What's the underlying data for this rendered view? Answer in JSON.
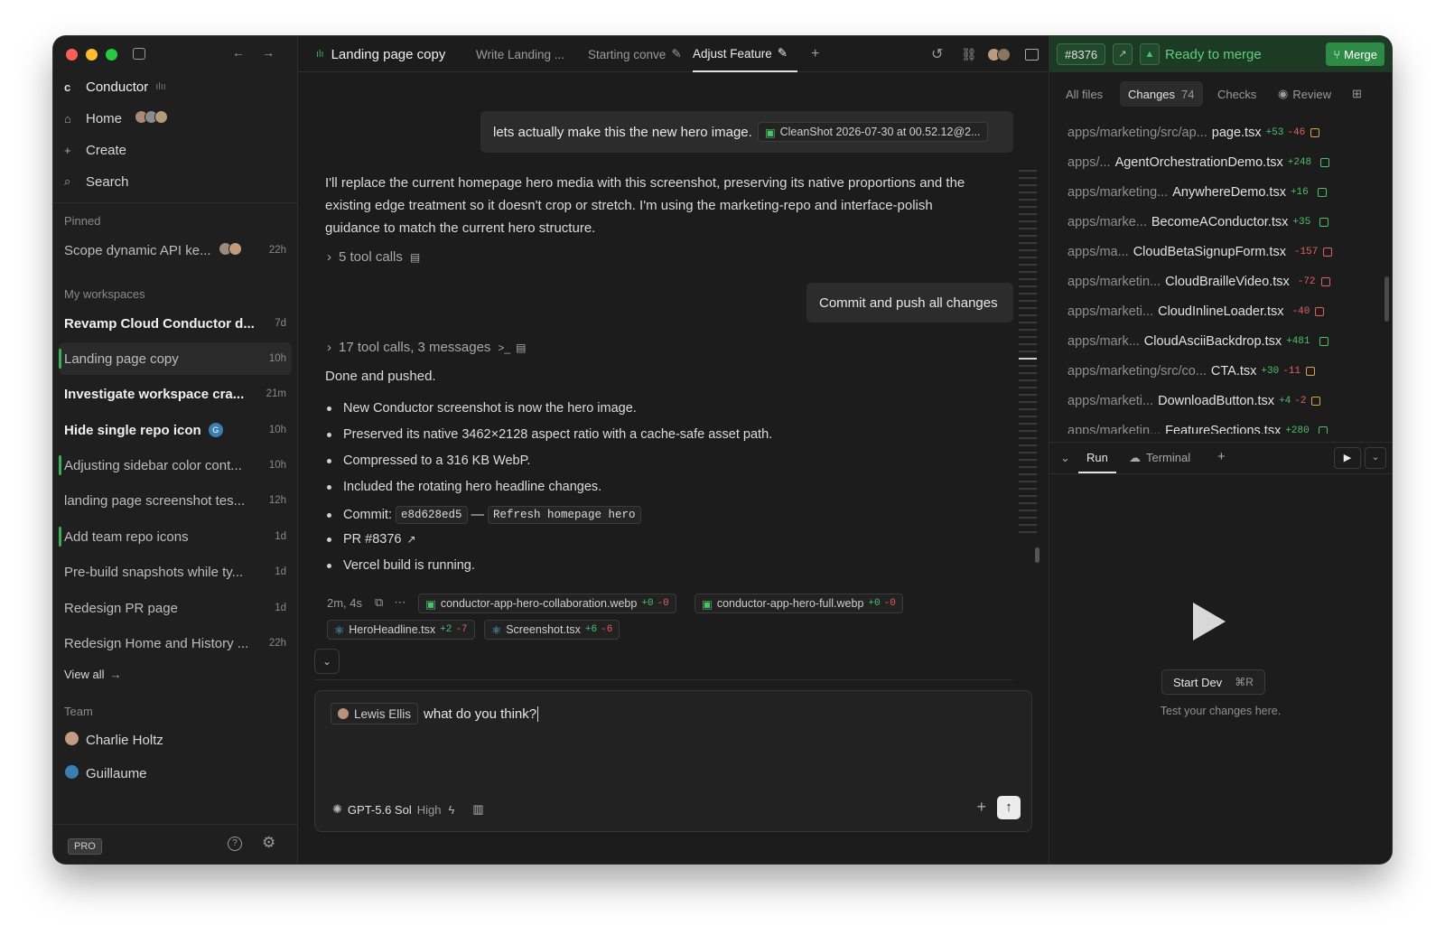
{
  "sidebar": {
    "app_name": "Conductor",
    "nav": [
      {
        "label": "Home",
        "icon": "home-icon"
      },
      {
        "label": "Create",
        "icon": "plus-icon"
      },
      {
        "label": "Search",
        "icon": "search-icon"
      }
    ],
    "pinned_heading": "Pinned",
    "pinned": [
      {
        "title": "Scope dynamic API ke...",
        "time": "22h"
      }
    ],
    "workspaces_heading": "My workspaces",
    "workspaces": [
      {
        "title": "Revamp Cloud Conductor d...",
        "time": "7d"
      },
      {
        "title": "Landing page copy",
        "time": "10h"
      },
      {
        "title": "Investigate workspace cra...",
        "time": "21m"
      },
      {
        "title": "Hide single repo icon",
        "time": "10h"
      },
      {
        "title": "Adjusting sidebar color cont...",
        "time": "10h"
      },
      {
        "title": "landing page screenshot tes...",
        "time": "12h"
      },
      {
        "title": "Add team repo icons",
        "time": "1d"
      },
      {
        "title": "Pre-build snapshots while ty...",
        "time": "1d"
      },
      {
        "title": "Redesign PR page",
        "time": "1d"
      },
      {
        "title": "Redesign Home and History ...",
        "time": "22h"
      }
    ],
    "view_all": "View all",
    "team_heading": "Team",
    "team": [
      "Charlie Holtz",
      "Guillaume"
    ],
    "pro_badge": "PRO",
    "repo_badge": "G"
  },
  "tabs": {
    "first": "Landing page copy",
    "items": [
      "Write Landing ...",
      "Starting conve",
      "Adjust Feature"
    ],
    "add": "+"
  },
  "chat": {
    "user_msg_1": "lets actually make this the new hero image.",
    "attachment": "CleanShot 2026-07-30 at 00.52.12@2...",
    "assistant_para": "I'll replace the current homepage hero media with this screenshot, preserving its native proportions and the existing edge treatment so it doesn't crop or stretch. I'm using the marketing-repo and interface-polish guidance to match the current hero structure.",
    "tool_calls_1": "5 tool calls",
    "user_msg_2": "Commit and push all changes",
    "tool_calls_2": "17 tool calls, 3 messages",
    "done": "Done and pushed.",
    "bullets": [
      "New Conductor screenshot is now the hero image.",
      "Preserved its native 3462×2128 aspect ratio with a cache-safe asset path.",
      "Compressed to a 316 KB WebP.",
      "Included the rotating hero headline changes."
    ],
    "commit_label": "Commit:",
    "commit_hash": "e8d628ed5",
    "commit_dash": "—",
    "commit_msg": "Refresh homepage hero",
    "pr_label": "PR #8376",
    "vercel": "Vercel build is running.",
    "duration": "2m, 4s",
    "file_chips": [
      {
        "name": "conductor-app-hero-collaboration.webp",
        "plus": "+0",
        "minus": "-0"
      },
      {
        "name": "conductor-app-hero-full.webp",
        "plus": "+0",
        "minus": "-0"
      },
      {
        "name": "HeroHeadline.tsx",
        "plus": "+2",
        "minus": "-7"
      },
      {
        "name": "Screenshot.tsx",
        "plus": "+6",
        "minus": "-6"
      }
    ]
  },
  "composer": {
    "mention": "Lewis Ellis",
    "text": "what do you think?",
    "model": "GPT-5.6 Sol",
    "effort": "High"
  },
  "right": {
    "pr_number": "#8376",
    "status": "Ready to merge",
    "merge": "Merge",
    "tabs": [
      "All files",
      "Changes",
      "Checks",
      "Review"
    ],
    "changes_count": "74",
    "files": [
      {
        "path": "apps/marketing/src/ap...",
        "name": "page.tsx",
        "plus": "+53",
        "minus": "-46",
        "kind": "mod"
      },
      {
        "path": "apps/...",
        "name": "AgentOrchestrationDemo.tsx",
        "plus": "+248",
        "minus": "",
        "kind": "add"
      },
      {
        "path": "apps/marketing...",
        "name": "AnywhereDemo.tsx",
        "plus": "+16",
        "minus": "",
        "kind": "add"
      },
      {
        "path": "apps/marke...",
        "name": "BecomeAConductor.tsx",
        "plus": "+35",
        "minus": "",
        "kind": "add"
      },
      {
        "path": "apps/ma...",
        "name": "CloudBetaSignupForm.tsx",
        "plus": "",
        "minus": "-157",
        "kind": "del"
      },
      {
        "path": "apps/marketin...",
        "name": "CloudBrailleVideo.tsx",
        "plus": "",
        "minus": "-72",
        "kind": "del"
      },
      {
        "path": "apps/marketi...",
        "name": "CloudInlineLoader.tsx",
        "plus": "",
        "minus": "-40",
        "kind": "del"
      },
      {
        "path": "apps/mark...",
        "name": "CloudAsciiBackdrop.tsx",
        "plus": "+481",
        "minus": "",
        "kind": "add"
      },
      {
        "path": "apps/marketing/src/co...",
        "name": "CTA.tsx",
        "plus": "+30",
        "minus": "-11",
        "kind": "mod"
      },
      {
        "path": "apps/marketi...",
        "name": "DownloadButton.tsx",
        "plus": "+4",
        "minus": "-2",
        "kind": "mod"
      },
      {
        "path": "apps/marketin...",
        "name": "FeatureSections.tsx",
        "plus": "+280",
        "minus": "",
        "kind": "add"
      }
    ],
    "run_tab": "Run",
    "terminal_tab": "Terminal",
    "start_dev": "Start Dev",
    "shortcut": "⌘R",
    "hint": "Test your changes here."
  },
  "colors": {
    "accent_green": "#3fae5a",
    "merge_green": "#2e8b46",
    "add": "#4cc06a",
    "del": "#e06060"
  }
}
